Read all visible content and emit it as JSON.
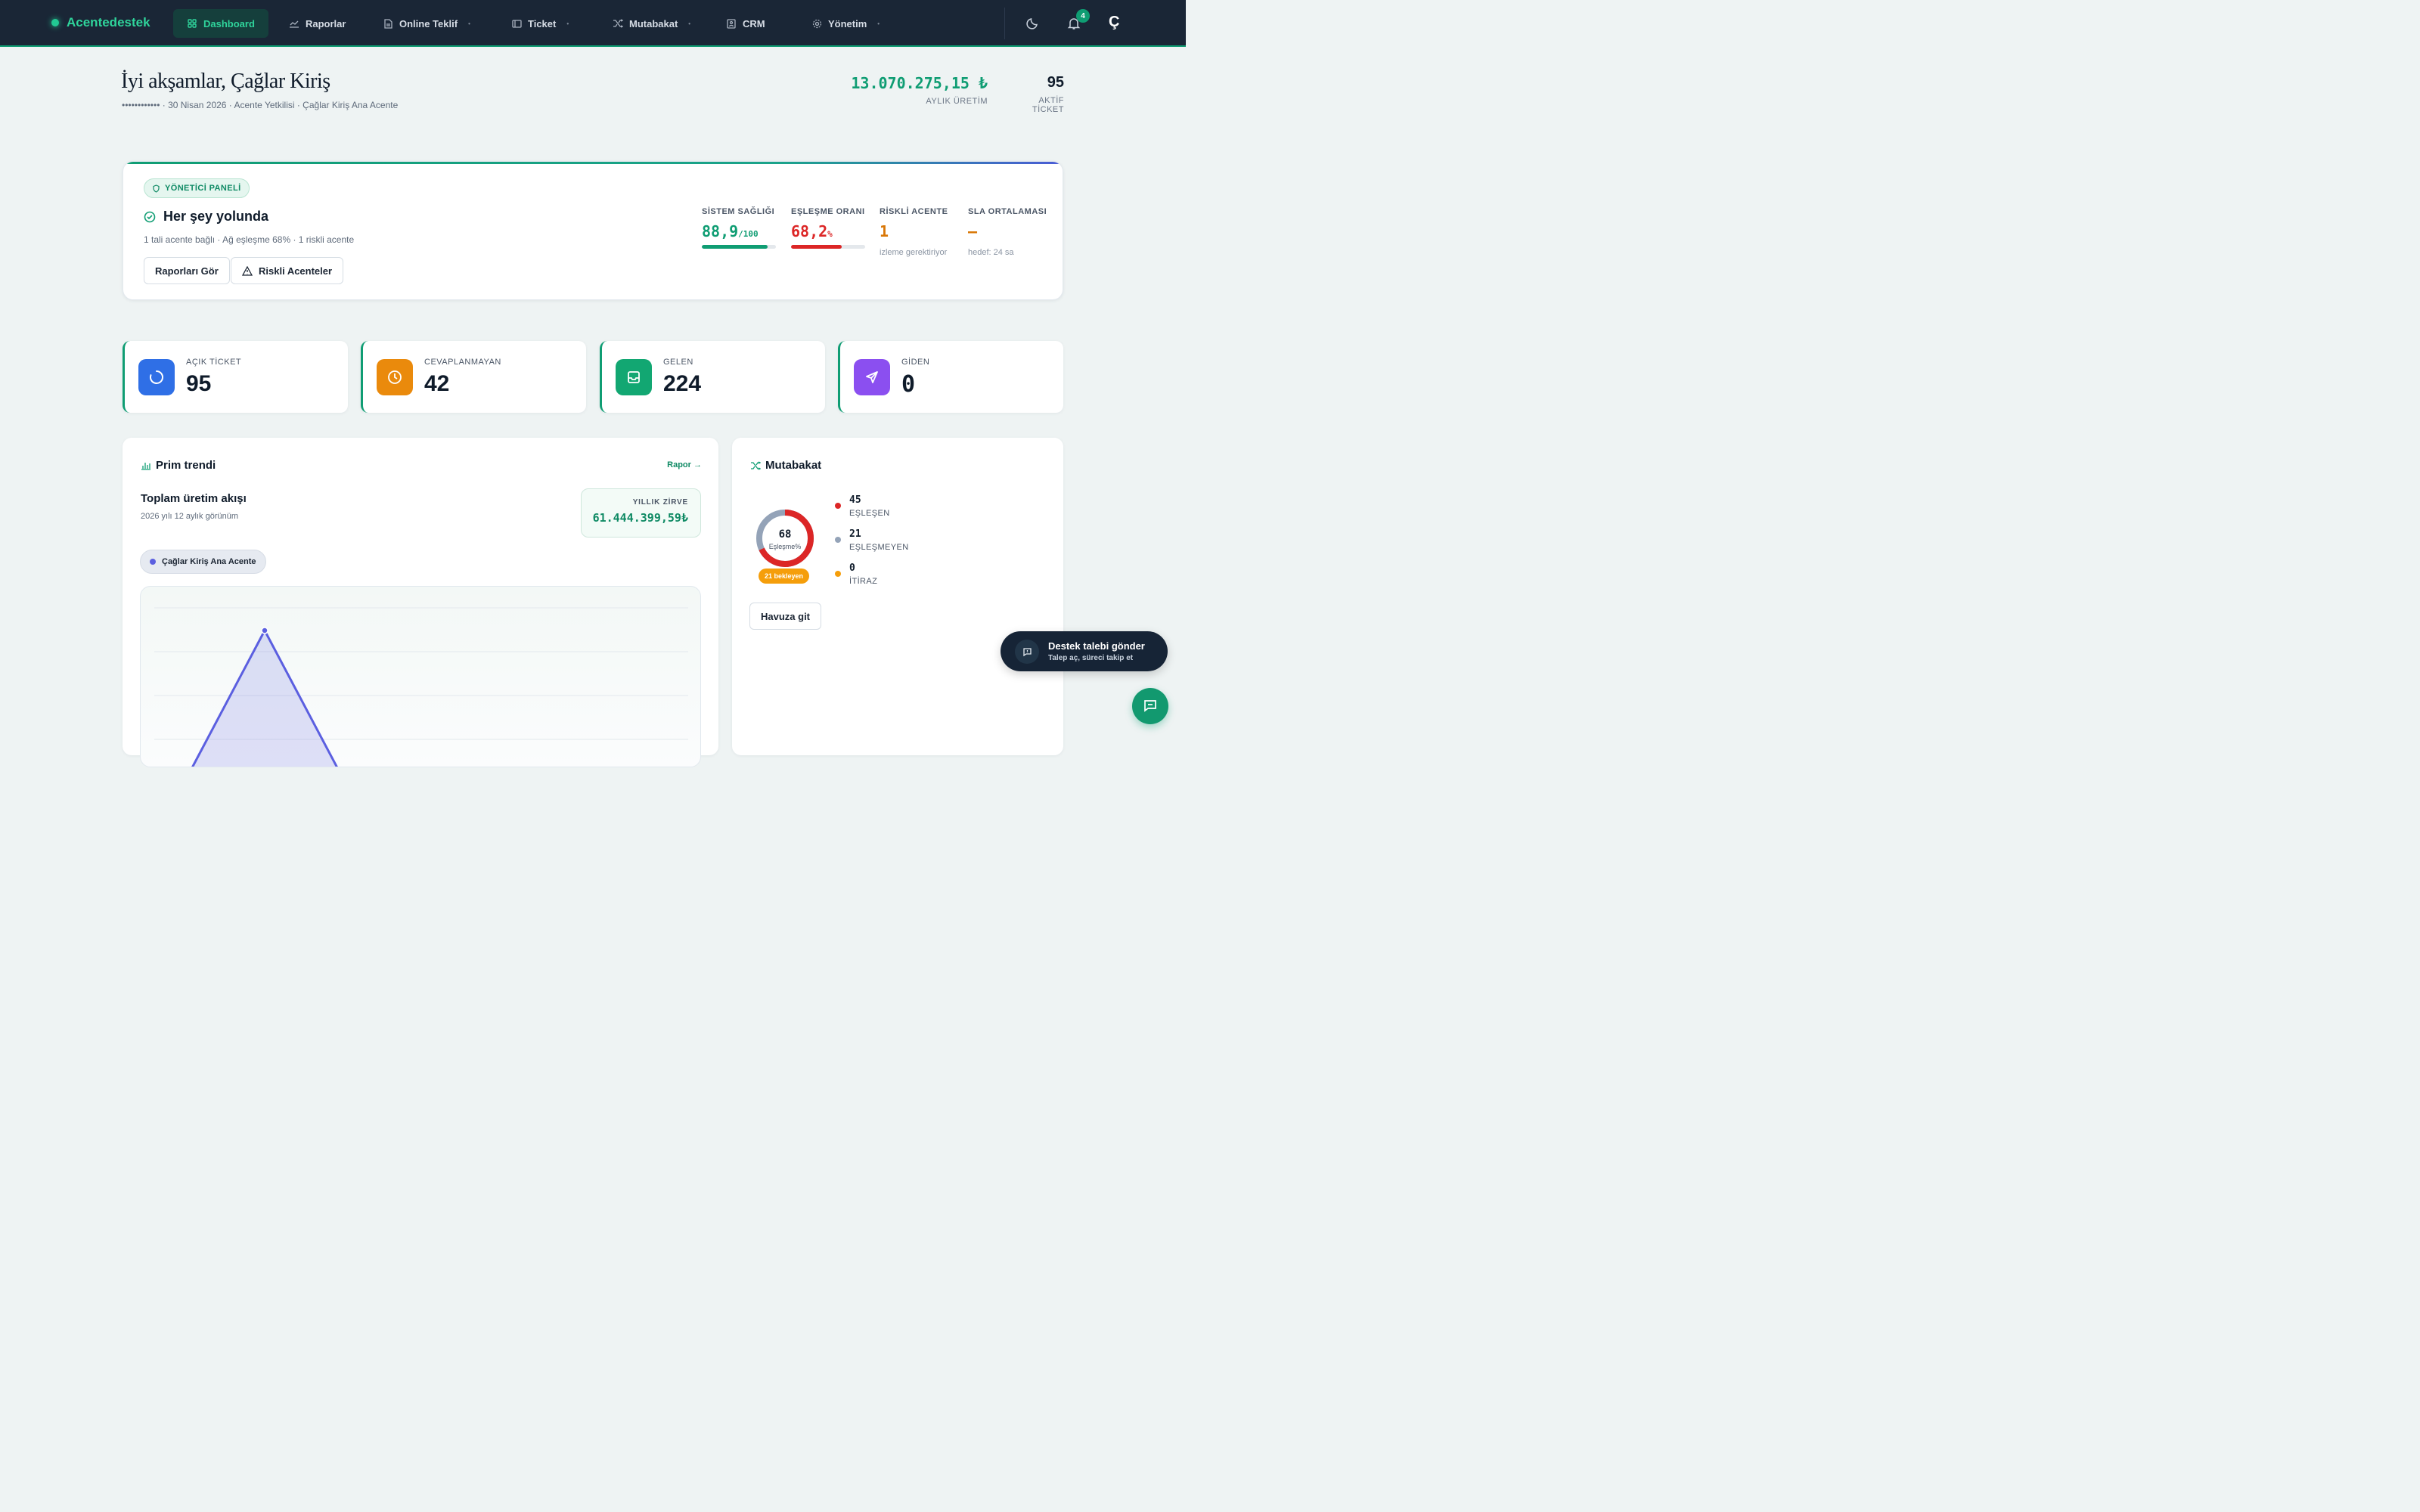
{
  "colors": {
    "accent": "#0f9d73",
    "nav_bg": "#1a2636",
    "danger": "#dc2626",
    "warning": "#d97706",
    "chart_line": "#5b5fe0"
  },
  "brand": {
    "name": "Acentedestek"
  },
  "nav": {
    "items": [
      {
        "label": "Dashboard",
        "icon": "grid-icon"
      },
      {
        "label": "Raporlar",
        "icon": "chart-line-icon"
      },
      {
        "label": "Online Teklif",
        "icon": "document-icon"
      },
      {
        "label": "Ticket",
        "icon": "ticket-icon"
      },
      {
        "label": "Mutabakat",
        "icon": "shuffle-icon"
      },
      {
        "label": "CRM",
        "icon": "contacts-icon"
      },
      {
        "label": "Yönetim",
        "icon": "gear-icon"
      }
    ],
    "notification_count": "4",
    "avatar_initial": "Ç"
  },
  "greeting": {
    "title": "İyi akşamlar, Çağlar Kiriş",
    "subtitle": "•••••••••••• · 30 Nisan 2026 · Acente Yetkilisi · Çağlar Kiriş Ana Acente"
  },
  "top_kpis": [
    {
      "value": "13.070.275,15 ₺",
      "label": "AYLIK ÜRETİM"
    },
    {
      "value": "95",
      "label": "AKTİF TİCKET"
    }
  ],
  "admin_panel": {
    "badge": "YÖNETİCİ PANELİ",
    "title": "Her şey yolunda",
    "subtitle": "1 tali acente bağlı · Ağ eşleşme 68% · 1 riskli acente",
    "buttons": [
      "Raporları Gör",
      "Riskli Acenteler"
    ],
    "metrics": [
      {
        "label": "SİSTEM SAĞLIĞI",
        "value": "88,9",
        "unit": "/100",
        "progress": 0.889
      },
      {
        "label": "EŞLEŞME ORANI",
        "value": "68,2",
        "unit": "%",
        "progress": 0.682
      },
      {
        "label": "RİSKLİ ACENTE",
        "value": "1",
        "note": "izleme gerektiriyor"
      },
      {
        "label": "SLA ORTALAMASI",
        "value": "–",
        "note": "hedef: 24 sa"
      }
    ]
  },
  "stats": [
    {
      "label": "AÇIK TİCKET",
      "value": "95",
      "icon": "spinner-icon",
      "color": "#2f6fe6"
    },
    {
      "label": "CEVAPLANMAYAN",
      "value": "42",
      "icon": "clock-icon",
      "color": "#ea8a0c"
    },
    {
      "label": "GELEN",
      "value": "224",
      "icon": "inbox-icon",
      "color": "#12a772"
    },
    {
      "label": "GİDEN",
      "value": "0",
      "icon": "send-icon",
      "color": "#8b4ff0"
    }
  ],
  "prim_trend": {
    "header": "Prim trendi",
    "link": "Rapor →",
    "title": "Toplam üretim akışı",
    "subtitle": "2026 yılı 12 aylık görünüm",
    "peak_label": "YILLIK ZİRVE",
    "peak_value": "61.444.399,59₺",
    "legend": "Çağlar Kiriş Ana Acente"
  },
  "chart_data": {
    "type": "area",
    "series": [
      {
        "name": "Çağlar Kiriş Ana Acente",
        "values": [
          0,
          61444399.59,
          0,
          0,
          0,
          0,
          0,
          0,
          0,
          0,
          0,
          0
        ]
      }
    ],
    "grid": true
  },
  "mutabakat": {
    "header": "Mutabakat",
    "center_value": "68",
    "center_label": "Eşleşme%",
    "pending": "21 bekleyen",
    "legend": [
      {
        "value": "45",
        "label": "EŞLEŞEN",
        "color": "#dc2626"
      },
      {
        "value": "21",
        "label": "EŞLEŞMEYEN",
        "color": "#94a3b8"
      },
      {
        "value": "0",
        "label": "İTİRAZ",
        "color": "#f59e0b"
      }
    ],
    "button": "Havuza git"
  },
  "support": {
    "title": "Destek talebi gönder",
    "subtitle": "Talep aç, süreci takip et"
  }
}
